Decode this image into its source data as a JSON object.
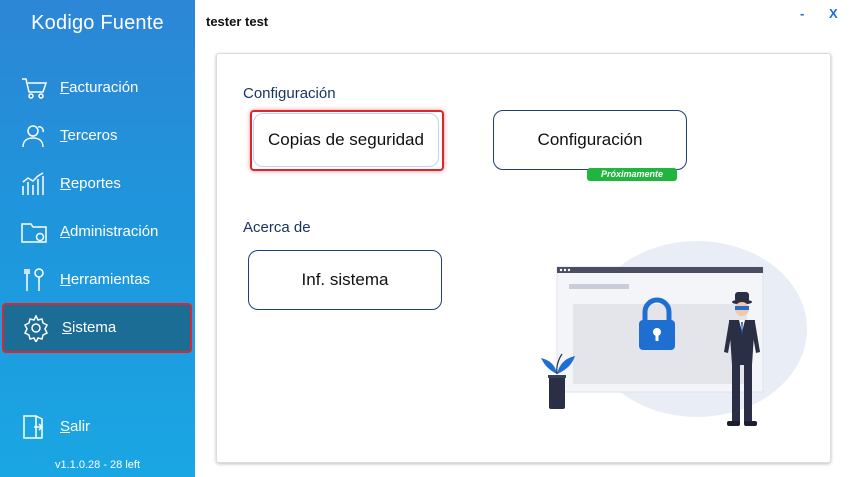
{
  "app": {
    "brand": "Kodigo Fuente",
    "user": "tester test",
    "version": "v1.1.0.28 - 28 left"
  },
  "window": {
    "minimize": "-",
    "close": "X"
  },
  "sidebar": {
    "items": [
      {
        "label": "Facturación",
        "icon": "cart-icon"
      },
      {
        "label": "Terceros",
        "icon": "users-icon"
      },
      {
        "label": "Reportes",
        "icon": "chart-icon"
      },
      {
        "label": "Administración",
        "icon": "folder-icon"
      },
      {
        "label": "Herramientas",
        "icon": "tools-icon"
      },
      {
        "label": "Sistema",
        "icon": "gear-icon"
      }
    ],
    "active": "Sistema",
    "logout": "Salir"
  },
  "main": {
    "config_section": "Configuración",
    "about_section": "Acerca de",
    "buttons": {
      "backups": "Copias de seguridad",
      "config": "Configuración",
      "sysinfo": "Inf. sistema"
    },
    "badge": "Próximamente"
  },
  "colors": {
    "accent": "#1f8fd9",
    "active_border": "#d9262f",
    "badge": "#20b53f",
    "heading": "#17335f"
  }
}
